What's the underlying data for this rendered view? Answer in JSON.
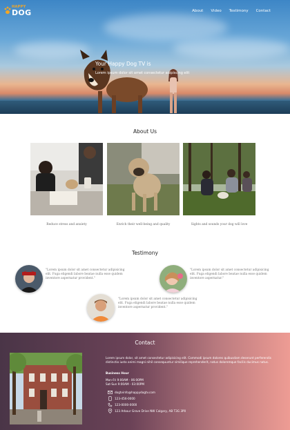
{
  "brand": {
    "small": "HAPPY",
    "big": "DOG"
  },
  "nav": {
    "items": [
      "About",
      "Video",
      "Testimony",
      "Contact"
    ]
  },
  "hero": {
    "title": "Your Happy Dog TV is",
    "subtitle": "Lorem ipsum dolor sit amet consectetur adipiscing elit"
  },
  "about": {
    "title": "About Us",
    "items": [
      {
        "caption": "Reduce stress and anxiety"
      },
      {
        "caption": "Enrich their well-being and quality"
      },
      {
        "caption": "Sights and sounds your dog will love"
      }
    ]
  },
  "testimony": {
    "title": "Testimony",
    "items": [
      {
        "quote": "\"Lorem ipsum dolor sit amet consectetur adipisicing elit. Fuga eligendi labore beatae nulla esse quidem inventore aspernatur provident.\""
      },
      {
        "quote": "\"Lorem ipsum dolor sit amet consectetur adipisicing elit. Fuga eligendi labore beatae nulla esse quidem inventore aspernatur.\""
      },
      {
        "quote": "\"Lorem ipsum dolor sit amet consectetur adipisicing elit. Fuga eligendi labore beatae nulla esse quidem inventore aspernatur provident.\""
      }
    ]
  },
  "contact": {
    "title": "Contact",
    "description": "Lorem ipsum dolor, sit amet consectetur adipisicing elit. Commodi ipsum dolores quibusdam deserunt perferendis distinctio iusto animi magni nihil consequuntur similique reprehenderit, natus doloremque facilis ducimus natus.",
    "hours_title": "Business Hour",
    "hours": [
      "Mon-Fri 9:00AM - 06:00PM",
      "Sat-Sun 9:00AM - 03:00PM"
    ],
    "email": "dogtvinfo@happydogtv.com",
    "phone1": "123-456-0000",
    "phone2": "123-0000-0000",
    "address": "123 Arbour Grove Drive NW Calgary, AB T3G 3P0"
  },
  "colors": {
    "accent": "#f5a623",
    "contact_start": "#4a3547",
    "contact_end": "#ee9c94"
  }
}
